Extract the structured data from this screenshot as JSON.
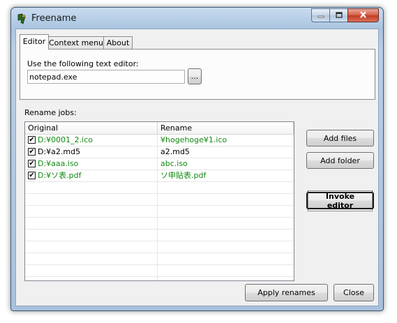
{
  "window": {
    "title": "Freename",
    "icon": "freename-app-icon"
  },
  "tabs": [
    {
      "label": "Editor",
      "active": true
    },
    {
      "label": "Context menu",
      "active": false
    },
    {
      "label": "About",
      "active": false
    }
  ],
  "editor": {
    "label": "Use the following text editor:",
    "value": "notepad.exe",
    "browse_label": "..."
  },
  "jobs": {
    "label": "Rename jobs:",
    "columns": [
      "Original",
      "Rename"
    ],
    "rows": [
      {
        "checked": true,
        "original": "D:¥0001_2.ico",
        "rename": "¥hogehoge¥1.ico",
        "changed": true
      },
      {
        "checked": true,
        "original": "D:¥a2.md5",
        "rename": "a2.md5",
        "changed": false
      },
      {
        "checked": true,
        "original": "D:¥aaa.iso",
        "rename": "abc.iso",
        "changed": true
      },
      {
        "checked": true,
        "original": "D:¥ソ表.pdf",
        "rename": "ソ申貼表.pdf",
        "changed": true
      }
    ],
    "empty_rows": 8
  },
  "buttons": {
    "add_files": "Add files",
    "add_folder": "Add folder",
    "invoke_editor": "Invoke editor",
    "apply_renames": "Apply renames",
    "close": "Close"
  },
  "colors": {
    "changed_text": "#138a13"
  }
}
